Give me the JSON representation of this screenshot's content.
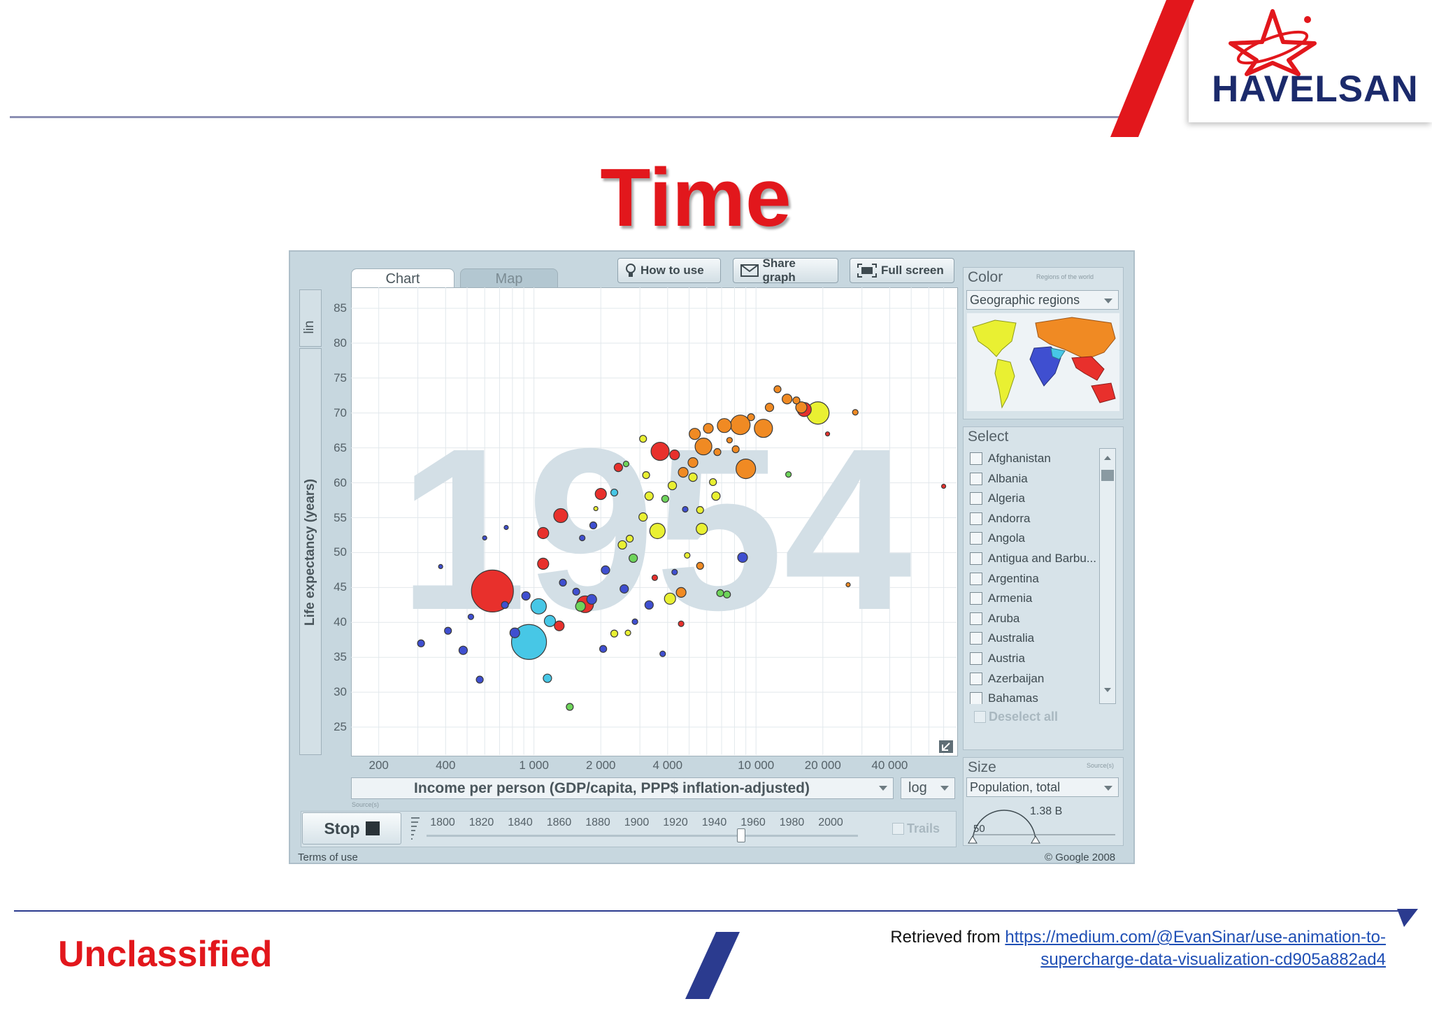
{
  "slide": {
    "title": "Time",
    "logo_text": "HAVELSAN",
    "classification": "Unclassified",
    "retrieved_prefix": "Retrieved from ",
    "retrieved_link_line1": "https://medium.com/@EvanSinar/use-animation-to-",
    "retrieved_link_line2": "supercharge-data-visualization-cd905a882ad4",
    "colors": {
      "title": "#e2171c",
      "logo_navy": "#1b2a6b",
      "rule_navy": "#2b3b8f"
    }
  },
  "app": {
    "tabs": [
      "Chart",
      "Map"
    ],
    "toolbar": {
      "how_to_use": "How to use",
      "share_graph": "Share graph",
      "full_screen": "Full screen"
    },
    "y_scale": "lin",
    "x_scale": "log",
    "source_label": "Source(s)",
    "stop_label": "Stop",
    "trails_label": "Trails",
    "terms": "Terms of use",
    "copyright": "© Google 2008",
    "year_ticks": [
      "1800",
      "1820",
      "1840",
      "1860",
      "1880",
      "1900",
      "1920",
      "1940",
      "1960",
      "1980",
      "2000"
    ],
    "current_year_value": 1954,
    "color_panel": {
      "title": "Color",
      "note": "Regions of the world",
      "selected": "Geographic regions"
    },
    "select_panel": {
      "title": "Select",
      "countries": [
        "Afghanistan",
        "Albania",
        "Algeria",
        "Andorra",
        "Angola",
        "Antigua and Barbu...",
        "Argentina",
        "Armenia",
        "Aruba",
        "Australia",
        "Austria",
        "Azerbaijan",
        "Bahamas"
      ],
      "deselect_all": "Deselect all"
    },
    "size_panel": {
      "title": "Size",
      "note": "Source(s)",
      "selected": "Population, total",
      "max_label": "1.38 B",
      "min_label": "50"
    }
  },
  "chart_data": {
    "type": "scatter",
    "year_watermark": "1954",
    "xlabel": "Income per person (GDP/capita, PPP$ inflation-adjusted)",
    "ylabel": "Life expectancy (years)",
    "x_scale": "log",
    "xlim": [
      150,
      80000
    ],
    "ylim": [
      21,
      88
    ],
    "x_ticks": [
      {
        "v": 200,
        "l": "200"
      },
      {
        "v": 400,
        "l": "400"
      },
      {
        "v": 1000,
        "l": "1 000"
      },
      {
        "v": 2000,
        "l": "2 000"
      },
      {
        "v": 4000,
        "l": "4 000"
      },
      {
        "v": 10000,
        "l": "10 000"
      },
      {
        "v": 20000,
        "l": "20 000"
      },
      {
        "v": 40000,
        "l": "40 000"
      }
    ],
    "y_ticks": [
      25,
      30,
      35,
      40,
      45,
      50,
      55,
      60,
      65,
      70,
      75,
      80,
      85
    ],
    "region_colors": {
      "asia": "#e8302c",
      "europe": "#f08a23",
      "americas": "#e9f032",
      "africa": "#3f4fd0",
      "mideast": "#47c7e6",
      "misc": "#6ed45a"
    },
    "points": [
      {
        "x": 650,
        "y": 44.5,
        "r": 30,
        "c": "asia"
      },
      {
        "x": 950,
        "y": 37.2,
        "r": 25,
        "c": "mideast"
      },
      {
        "x": 19000,
        "y": 70.0,
        "r": 16,
        "c": "americas"
      },
      {
        "x": 9000,
        "y": 62,
        "r": 14,
        "c": "europe"
      },
      {
        "x": 3700,
        "y": 64.5,
        "r": 13,
        "c": "asia"
      },
      {
        "x": 8500,
        "y": 68.3,
        "r": 14,
        "c": "europe"
      },
      {
        "x": 10800,
        "y": 67.8,
        "r": 13,
        "c": "europe"
      },
      {
        "x": 7200,
        "y": 68.2,
        "r": 10,
        "c": "europe"
      },
      {
        "x": 16500,
        "y": 70.5,
        "r": 10,
        "c": "asia"
      },
      {
        "x": 5800,
        "y": 65.2,
        "r": 12,
        "c": "europe"
      },
      {
        "x": 1700,
        "y": 42.6,
        "r": 12,
        "c": "asia"
      },
      {
        "x": 1320,
        "y": 55.3,
        "r": 10,
        "c": "asia"
      },
      {
        "x": 1100,
        "y": 52.8,
        "r": 8,
        "c": "asia"
      },
      {
        "x": 1100,
        "y": 48.4,
        "r": 8,
        "c": "asia"
      },
      {
        "x": 3600,
        "y": 53.1,
        "r": 11,
        "c": "americas"
      },
      {
        "x": 5700,
        "y": 53.4,
        "r": 8,
        "c": "americas"
      },
      {
        "x": 8700,
        "y": 49.3,
        "r": 7,
        "c": "africa"
      },
      {
        "x": 1050,
        "y": 42.3,
        "r": 11,
        "c": "mideast"
      },
      {
        "x": 1180,
        "y": 40.2,
        "r": 8,
        "c": "mideast"
      },
      {
        "x": 1820,
        "y": 43.3,
        "r": 7,
        "c": "africa"
      },
      {
        "x": 1300,
        "y": 39.5,
        "r": 7,
        "c": "asia"
      },
      {
        "x": 4100,
        "y": 43.4,
        "r": 8,
        "c": "americas"
      },
      {
        "x": 4600,
        "y": 44.3,
        "r": 7,
        "c": "europe"
      },
      {
        "x": 1620,
        "y": 42.3,
        "r": 7,
        "c": "misc"
      },
      {
        "x": 2000,
        "y": 58.4,
        "r": 8,
        "c": "asia"
      },
      {
        "x": 2400,
        "y": 62.2,
        "r": 6,
        "c": "asia"
      },
      {
        "x": 3100,
        "y": 55.1,
        "r": 6,
        "c": "americas"
      },
      {
        "x": 2500,
        "y": 51.1,
        "r": 6,
        "c": "americas"
      },
      {
        "x": 2100,
        "y": 47.5,
        "r": 6,
        "c": "africa"
      },
      {
        "x": 2800,
        "y": 49.2,
        "r": 6,
        "c": "misc"
      },
      {
        "x": 3300,
        "y": 58.1,
        "r": 6,
        "c": "americas"
      },
      {
        "x": 4200,
        "y": 59.6,
        "r": 6,
        "c": "americas"
      },
      {
        "x": 5200,
        "y": 60.8,
        "r": 6,
        "c": "americas"
      },
      {
        "x": 6600,
        "y": 58.1,
        "r": 6,
        "c": "americas"
      },
      {
        "x": 5300,
        "y": 67.0,
        "r": 8,
        "c": "europe"
      },
      {
        "x": 6100,
        "y": 67.8,
        "r": 7,
        "c": "europe"
      },
      {
        "x": 4700,
        "y": 61.5,
        "r": 7,
        "c": "europe"
      },
      {
        "x": 5200,
        "y": 62.9,
        "r": 7,
        "c": "europe"
      },
      {
        "x": 4300,
        "y": 64.0,
        "r": 7,
        "c": "asia"
      },
      {
        "x": 11500,
        "y": 70.8,
        "r": 6,
        "c": "europe"
      },
      {
        "x": 13800,
        "y": 72.0,
        "r": 7,
        "c": "europe"
      },
      {
        "x": 12500,
        "y": 73.4,
        "r": 5,
        "c": "europe"
      },
      {
        "x": 16000,
        "y": 70.8,
        "r": 8,
        "c": "europe"
      },
      {
        "x": 15200,
        "y": 71.8,
        "r": 5,
        "c": "europe"
      },
      {
        "x": 28000,
        "y": 70.1,
        "r": 4,
        "c": "europe"
      },
      {
        "x": 14000,
        "y": 61.2,
        "r": 4,
        "c": "misc"
      },
      {
        "x": 26000,
        "y": 45.4,
        "r": 3,
        "c": "europe"
      },
      {
        "x": 70000,
        "y": 59.5,
        "r": 3,
        "c": "asia"
      },
      {
        "x": 21000,
        "y": 67.0,
        "r": 3,
        "c": "asia"
      },
      {
        "x": 380,
        "y": 48.0,
        "r": 3,
        "c": "africa"
      },
      {
        "x": 310,
        "y": 37.0,
        "r": 5,
        "c": "africa"
      },
      {
        "x": 480,
        "y": 36.0,
        "r": 6,
        "c": "africa"
      },
      {
        "x": 570,
        "y": 31.8,
        "r": 5,
        "c": "africa"
      },
      {
        "x": 1450,
        "y": 27.9,
        "r": 5,
        "c": "misc"
      },
      {
        "x": 1150,
        "y": 32.0,
        "r": 6,
        "c": "mideast"
      },
      {
        "x": 410,
        "y": 38.8,
        "r": 5,
        "c": "africa"
      },
      {
        "x": 520,
        "y": 40.8,
        "r": 4,
        "c": "africa"
      },
      {
        "x": 820,
        "y": 38.5,
        "r": 7,
        "c": "africa"
      },
      {
        "x": 920,
        "y": 43.8,
        "r": 6,
        "c": "africa"
      },
      {
        "x": 740,
        "y": 42.5,
        "r": 5,
        "c": "africa"
      },
      {
        "x": 1350,
        "y": 45.7,
        "r": 5,
        "c": "africa"
      },
      {
        "x": 1550,
        "y": 44.4,
        "r": 5,
        "c": "africa"
      },
      {
        "x": 2550,
        "y": 44.8,
        "r": 6,
        "c": "africa"
      },
      {
        "x": 3300,
        "y": 42.5,
        "r": 6,
        "c": "africa"
      },
      {
        "x": 2050,
        "y": 36.2,
        "r": 5,
        "c": "africa"
      },
      {
        "x": 2300,
        "y": 38.4,
        "r": 5,
        "c": "americas"
      },
      {
        "x": 1650,
        "y": 52.1,
        "r": 4,
        "c": "africa"
      },
      {
        "x": 1850,
        "y": 53.9,
        "r": 5,
        "c": "africa"
      },
      {
        "x": 2700,
        "y": 52.0,
        "r": 5,
        "c": "americas"
      },
      {
        "x": 2300,
        "y": 58.6,
        "r": 5,
        "c": "mideast"
      },
      {
        "x": 3200,
        "y": 61.1,
        "r": 5,
        "c": "americas"
      },
      {
        "x": 3900,
        "y": 57.7,
        "r": 5,
        "c": "misc"
      },
      {
        "x": 5600,
        "y": 56.1,
        "r": 5,
        "c": "americas"
      },
      {
        "x": 6400,
        "y": 60.1,
        "r": 5,
        "c": "americas"
      },
      {
        "x": 5600,
        "y": 48.1,
        "r": 5,
        "c": "europe"
      },
      {
        "x": 6900,
        "y": 44.2,
        "r": 5,
        "c": "misc"
      },
      {
        "x": 7400,
        "y": 44.0,
        "r": 5,
        "c": "misc"
      },
      {
        "x": 3100,
        "y": 66.3,
        "r": 5,
        "c": "americas"
      },
      {
        "x": 8100,
        "y": 64.8,
        "r": 5,
        "c": "europe"
      },
      {
        "x": 7600,
        "y": 66.1,
        "r": 4,
        "c": "europe"
      },
      {
        "x": 9500,
        "y": 69.4,
        "r": 5,
        "c": "europe"
      },
      {
        "x": 6700,
        "y": 64.4,
        "r": 5,
        "c": "europe"
      },
      {
        "x": 4800,
        "y": 56.2,
        "r": 4,
        "c": "africa"
      },
      {
        "x": 3500,
        "y": 46.4,
        "r": 4,
        "c": "asia"
      },
      {
        "x": 2600,
        "y": 62.7,
        "r": 4,
        "c": "misc"
      },
      {
        "x": 2850,
        "y": 40.1,
        "r": 4,
        "c": "africa"
      },
      {
        "x": 2650,
        "y": 38.5,
        "r": 4,
        "c": "americas"
      },
      {
        "x": 3800,
        "y": 35.5,
        "r": 4,
        "c": "africa"
      },
      {
        "x": 4600,
        "y": 39.8,
        "r": 4,
        "c": "asia"
      },
      {
        "x": 600,
        "y": 52.1,
        "r": 3,
        "c": "africa"
      },
      {
        "x": 750,
        "y": 53.6,
        "r": 3,
        "c": "africa"
      },
      {
        "x": 1900,
        "y": 56.3,
        "r": 3,
        "c": "americas"
      },
      {
        "x": 4900,
        "y": 49.6,
        "r": 4,
        "c": "americas"
      },
      {
        "x": 4300,
        "y": 47.2,
        "r": 4,
        "c": "africa"
      }
    ]
  }
}
